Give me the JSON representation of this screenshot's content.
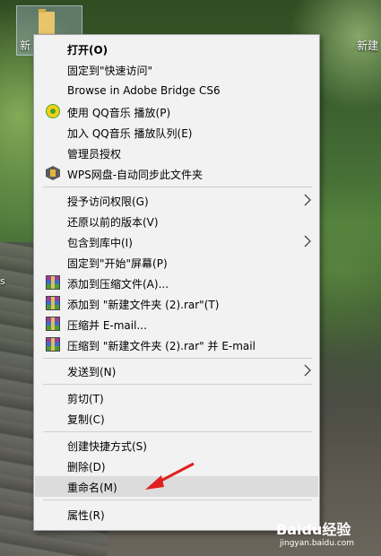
{
  "desktop": {
    "icon_left_label": "新",
    "icon_right_label": "新建",
    "left_text": "s"
  },
  "menu": {
    "items": [
      {
        "label": "打开(O)",
        "bold": true
      },
      {
        "label": "固定到\"快速访问\""
      },
      {
        "label": "Browse in Adobe Bridge CS6"
      },
      {
        "label": "使用 QQ音乐 播放(P)",
        "icon": "qq-music-icon"
      },
      {
        "label": "加入 QQ音乐 播放队列(E)"
      },
      {
        "label": "管理员授权"
      },
      {
        "label": "WPS网盘-自动同步此文件夹",
        "icon": "wps-cloud-icon"
      },
      {
        "label": "授予访问权限(G)",
        "submenu": true
      },
      {
        "label": "还原以前的版本(V)"
      },
      {
        "label": "包含到库中(I)",
        "submenu": true
      },
      {
        "label": "固定到\"开始\"屏幕(P)"
      },
      {
        "label": "添加到压缩文件(A)...",
        "icon": "winrar-icon"
      },
      {
        "label": "添加到 \"新建文件夹 (2).rar\"(T)",
        "icon": "winrar-icon"
      },
      {
        "label": "压缩并 E-mail...",
        "icon": "winrar-icon"
      },
      {
        "label": "压缩到 \"新建文件夹 (2).rar\" 并 E-mail",
        "icon": "winrar-icon"
      },
      {
        "label": "发送到(N)",
        "submenu": true
      },
      {
        "label": "剪切(T)"
      },
      {
        "label": "复制(C)"
      },
      {
        "label": "创建快捷方式(S)"
      },
      {
        "label": "删除(D)"
      },
      {
        "label": "重命名(M)",
        "highlighted": true
      },
      {
        "label": "属性(R)"
      }
    ]
  },
  "watermark": {
    "brand": "Baidu经验",
    "url": "jingyan.baidu.com"
  },
  "colors": {
    "menu_bg": "#f2f2f2",
    "highlight": "#dcdcdc",
    "pointer_red": "#e02020"
  }
}
